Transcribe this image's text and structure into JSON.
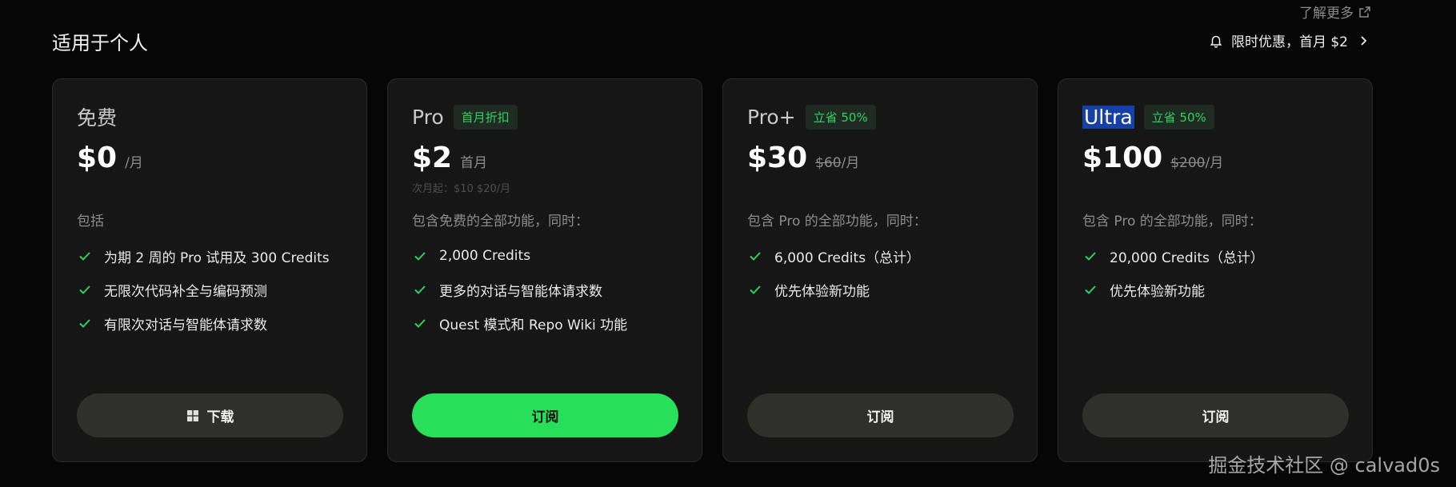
{
  "header": {
    "learn_more": "了解更多",
    "section_title": "适用于个人",
    "promo": "限时优惠，首月 $2"
  },
  "plans": [
    {
      "name": "免费",
      "price": "$0",
      "period": "/月",
      "intro": "包括",
      "features": [
        "为期 2 周的 Pro 试用及 300 Credits",
        "无限次代码补全与编码预测",
        "有限次对话与智能体请求数"
      ],
      "cta": "下载"
    },
    {
      "name": "Pro",
      "badge": "首月折扣",
      "price": "$2",
      "period": "首月",
      "next_month": "次月起：$10 $20/月",
      "intro": "包含免费的全部功能，同时：",
      "features": [
        "2,000 Credits",
        "更多的对话与智能体请求数",
        "Quest 模式和 Repo Wiki 功能"
      ],
      "cta": "订阅"
    },
    {
      "name": "Pro+",
      "badge": "立省 50%",
      "price": "$30",
      "original_price": "$60",
      "period": "/月",
      "intro": "包含 Pro 的全部功能，同时：",
      "features": [
        "6,000 Credits（总计）",
        "优先体验新功能"
      ],
      "cta": "订阅"
    },
    {
      "name": "Ultra",
      "badge": "立省 50%",
      "price": "$100",
      "original_price": "$200",
      "period": "/月",
      "intro": "包含 Pro 的全部功能，同时：",
      "features": [
        "20,000 Credits（总计）",
        "优先体验新功能"
      ],
      "cta": "订阅"
    }
  ],
  "watermark": "掘金技术社区 @ calvad0s",
  "colors": {
    "accent": "#28df5a",
    "badge_text": "#2fd35e",
    "card_bg": "#161616",
    "page_bg": "#060606",
    "selection": "#1740a6"
  },
  "icons": {
    "learn_more": "external-link-icon",
    "promo": "bell-icon",
    "promo_arrow": "chevron-right-icon",
    "feature": "check-icon",
    "download": "windows-icon"
  }
}
